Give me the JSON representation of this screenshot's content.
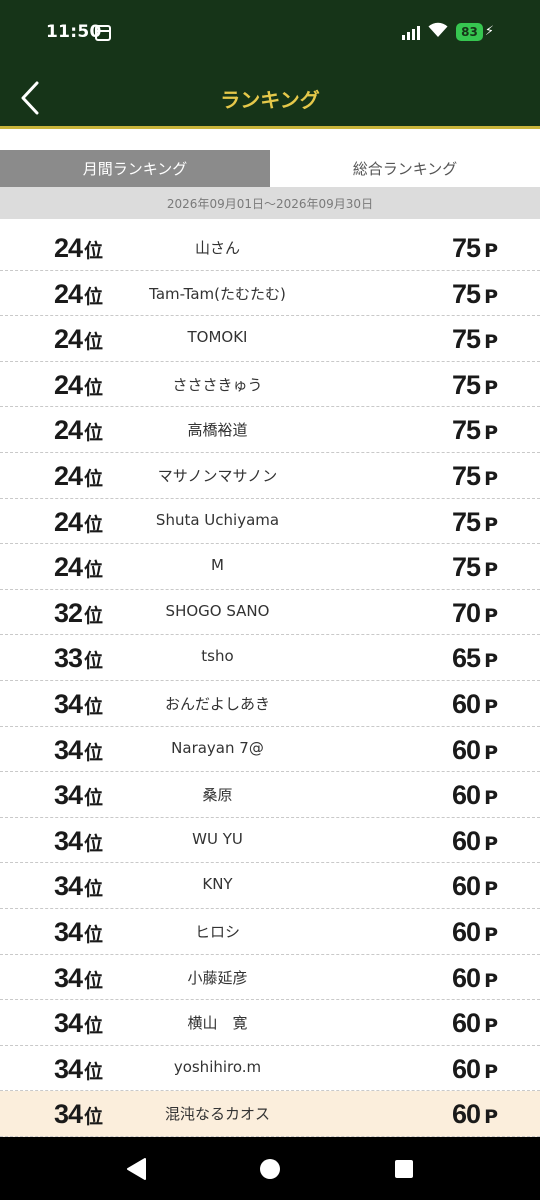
{
  "status_bar": {
    "time": "11:50",
    "battery": "83"
  },
  "header": {
    "title": "ランキング"
  },
  "tabs": [
    {
      "label": "月間ランキング",
      "active": true
    },
    {
      "label": "総合ランキング",
      "active": false
    }
  ],
  "date_range": "2026年09月01日～2026年09月30日",
  "rank_unit": "位",
  "point_unit": "P",
  "rows": [
    {
      "rank": "24",
      "name": "山さん",
      "points": "75"
    },
    {
      "rank": "24",
      "name": "Tam-Tam(たむたむ)",
      "points": "75"
    },
    {
      "rank": "24",
      "name": "TOMOKI",
      "points": "75"
    },
    {
      "rank": "24",
      "name": "さささきゅう",
      "points": "75"
    },
    {
      "rank": "24",
      "name": "高橋裕道",
      "points": "75"
    },
    {
      "rank": "24",
      "name": "マサノンマサノン",
      "points": "75"
    },
    {
      "rank": "24",
      "name": "Shuta Uchiyama",
      "points": "75"
    },
    {
      "rank": "24",
      "name": "M",
      "points": "75"
    },
    {
      "rank": "32",
      "name": "SHOGO SANO",
      "points": "70"
    },
    {
      "rank": "33",
      "name": "tsho",
      "points": "65"
    },
    {
      "rank": "34",
      "name": "おんだよしあき",
      "points": "60"
    },
    {
      "rank": "34",
      "name": "Narayan 7@",
      "points": "60"
    },
    {
      "rank": "34",
      "name": "桑原",
      "points": "60"
    },
    {
      "rank": "34",
      "name": "WU YU",
      "points": "60"
    },
    {
      "rank": "34",
      "name": "KNY",
      "points": "60"
    },
    {
      "rank": "34",
      "name": "ヒロシ",
      "points": "60"
    },
    {
      "rank": "34",
      "name": "小藤延彦",
      "points": "60"
    },
    {
      "rank": "34",
      "name": "横山　寛",
      "points": "60"
    },
    {
      "rank": "34",
      "name": "yoshihiro.m",
      "points": "60"
    },
    {
      "rank": "34",
      "name": "混沌なるカオス",
      "points": "60",
      "highlight": true
    }
  ]
}
